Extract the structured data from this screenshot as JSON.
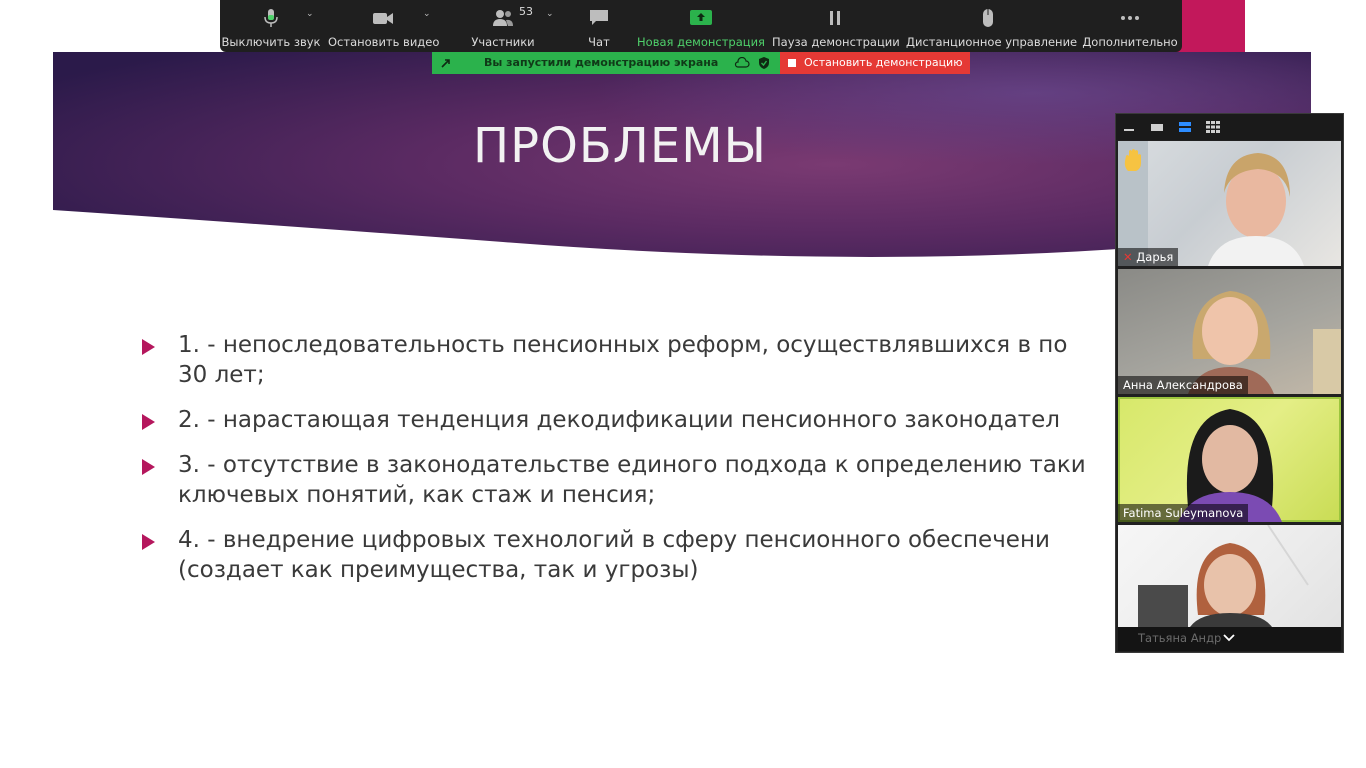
{
  "toolbar": {
    "mute_label": "Выключить звук",
    "video_label": "Остановить видео",
    "participants_label": "Участники",
    "participants_count": "53",
    "chat_label": "Чат",
    "new_share_label": "Новая демонстрация",
    "pause_share_label": "Пауза демонстрации",
    "remote_control_label": "Дистанционное управление",
    "more_label": "Дополнительно"
  },
  "share_banner": {
    "text": "Вы запустили демонстрацию экрана",
    "stop_label": "Остановить демонстрацию"
  },
  "slide": {
    "title": "ПРОБЛЕМЫ",
    "bullets": [
      {
        "line1": "1. - непоследовательность пенсионных реформ, осуществлявшихся в по",
        "line2": "30 лет;"
      },
      {
        "line1": "2. - нарастающая тенденция декодификации пенсионного законодател",
        "line2": ""
      },
      {
        "line1": "3. - отсутствие в законодательстве единого подхода к определению таки",
        "line2": "ключевых понятий, как стаж и пенсия;"
      },
      {
        "line1": "4. - внедрение цифровых технологий в сферу пенсионного обеспечени",
        "line2": "(создает как преимущества, так  и угрозы)"
      }
    ]
  },
  "gallery": {
    "participants": [
      {
        "name": "Дарья"
      },
      {
        "name": "Анна Александрова"
      },
      {
        "name": "Fatima Suleymanova"
      },
      {
        "name": "Татьяна Андр"
      }
    ]
  },
  "colors": {
    "accent_pink": "#c2185b",
    "bullet_arrow": "#b5175d",
    "share_green": "#2bb24c",
    "stop_red": "#e53935",
    "active_speaker": "#9bc53d"
  }
}
